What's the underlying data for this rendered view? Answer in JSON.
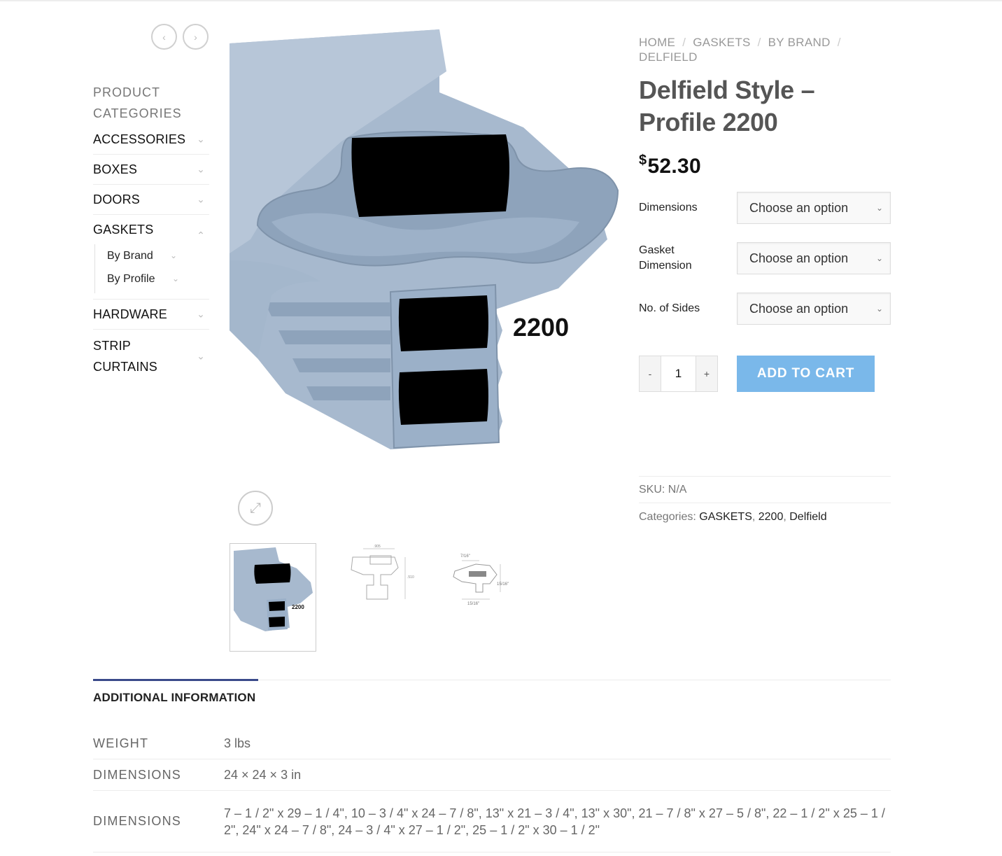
{
  "sidebar": {
    "heading": "PRODUCT CATEGORIES",
    "categories": [
      {
        "label": "ACCESSORIES"
      },
      {
        "label": "BOXES"
      },
      {
        "label": "DOORS"
      },
      {
        "label": "GASKETS",
        "sub": [
          {
            "label": "By Brand"
          },
          {
            "label": "By Profile"
          }
        ]
      },
      {
        "label": "HARDWARE"
      },
      {
        "label": "STRIP CURTAINS"
      }
    ]
  },
  "gallery": {
    "profile_label": "2200",
    "thumb_labels": [
      "2200"
    ],
    "diagram_labels": {
      "t2_top": ".905",
      "t2_side": ".510",
      "t3_top": "7/16\"",
      "t3_side": "15/16\"",
      "t3_bottom": "15/16\""
    }
  },
  "breadcrumb": [
    "HOME",
    "GASKETS",
    "BY BRAND",
    "DELFIELD"
  ],
  "product": {
    "title": "Delfield Style – Profile 2200",
    "currency": "$",
    "price": "52.30"
  },
  "variations": [
    {
      "label": "Dimensions",
      "selected": "Choose an option"
    },
    {
      "label": "Gasket Dimension",
      "selected": "Choose an option"
    },
    {
      "label": "No. of Sides",
      "selected": "Choose an option"
    }
  ],
  "cart": {
    "minus": "-",
    "quantity": "1",
    "plus": "+",
    "add_label": "ADD TO CART"
  },
  "meta": {
    "sku_label": "SKU:",
    "sku_value": "N/A",
    "categories_label": "Categories:",
    "categories": [
      "GASKETS",
      "2200",
      "Delfield"
    ]
  },
  "tabs": {
    "active": "ADDITIONAL INFORMATION"
  },
  "additional_info": [
    {
      "key": "WEIGHT",
      "value": "3 lbs"
    },
    {
      "key": "DIMENSIONS",
      "value": "24 × 24 × 3 in"
    },
    {
      "key": "DIMENSIONS",
      "value": "7 – 1 / 2\" x 29 – 1 / 4\", 10 – 3 / 4\" x 24 – 7 / 8\", 13\" x 21 – 3 / 4\", 13\" x 30\", 21 – 7 / 8\" x 27 – 5 / 8\", 22 – 1 / 2\" x 25 – 1 / 2\", 24\" x 24 – 7 / 8\", 24 – 3 / 4\" x 27 – 1 / 2\", 25 – 1 / 2\" x 30 – 1 / 2\""
    }
  ]
}
